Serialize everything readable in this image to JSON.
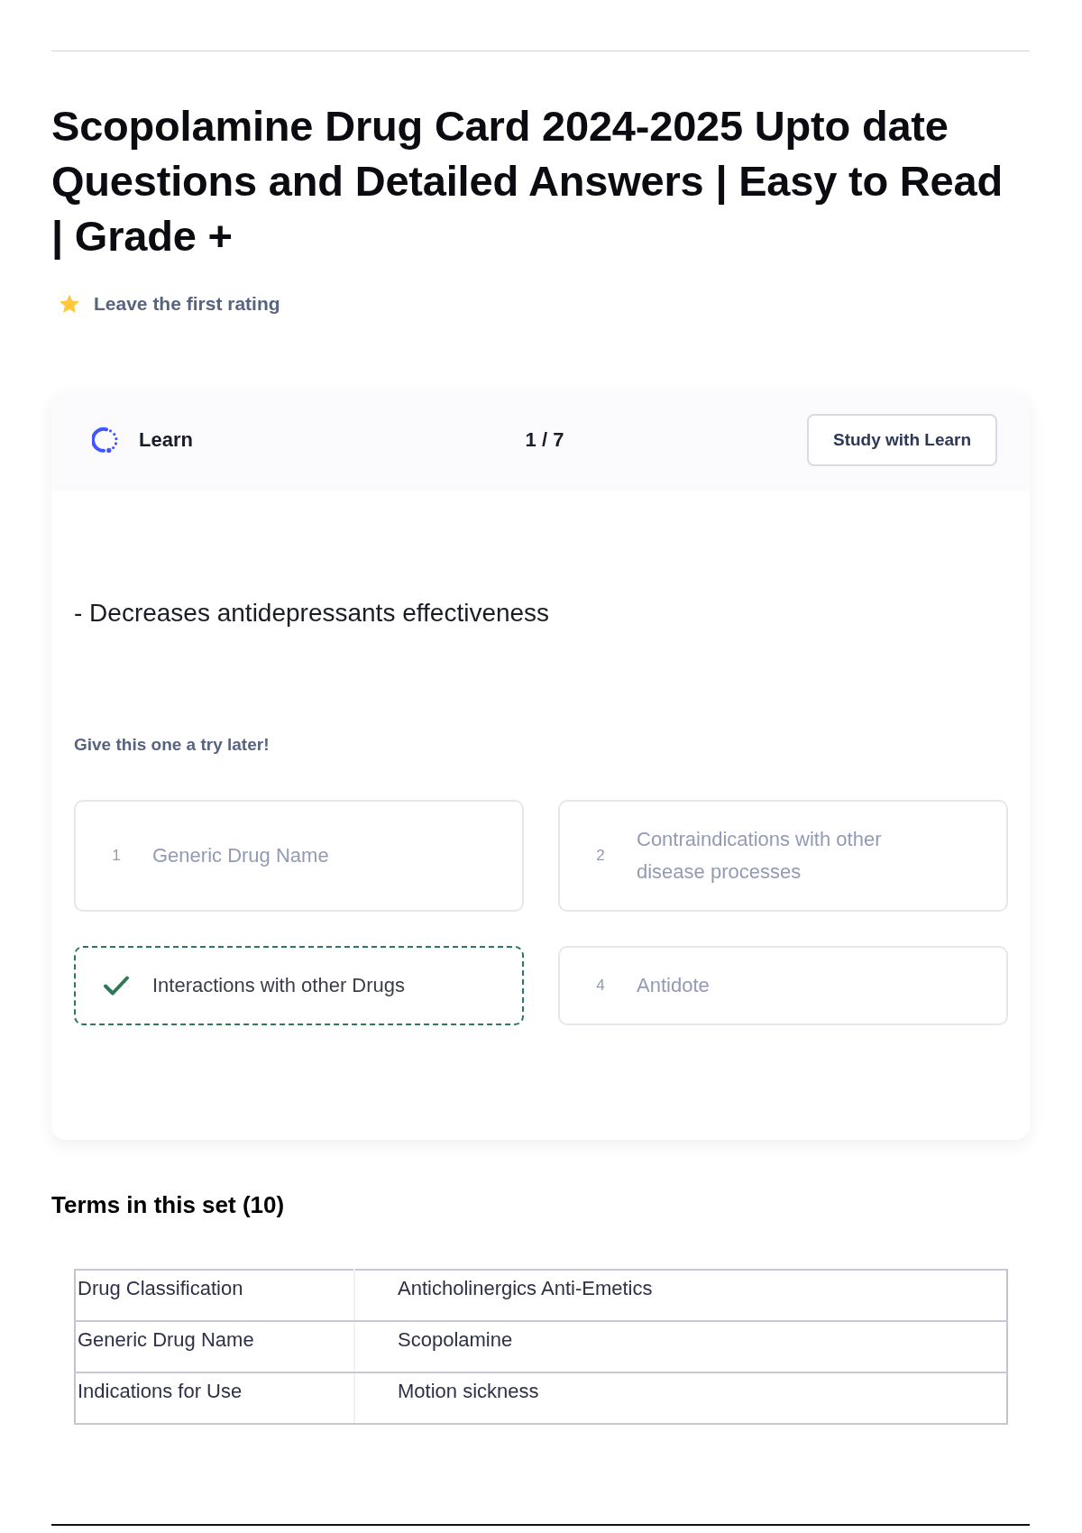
{
  "page": {
    "title": "Scopolamine Drug Card 2024-2025 Upto date Questions and Detailed Answers | Easy to Read | Grade +",
    "rating": {
      "label": "Leave the first rating"
    }
  },
  "learn_card": {
    "mode": "Learn",
    "progress": "1 / 7",
    "study_button": "Study with Learn",
    "answer": "- Decreases antidepressants effectiveness",
    "hint": "Give this one a try later!",
    "options": [
      {
        "number": "1",
        "text": "Generic Drug Name",
        "selected": false
      },
      {
        "number": "2",
        "text": "Contraindications with other disease processes",
        "selected": false
      },
      {
        "text": "Interactions with other Drugs",
        "selected": true
      },
      {
        "number": "4",
        "text": "Antidote",
        "selected": false
      }
    ]
  },
  "terms": {
    "heading": "Terms in this set (10)",
    "rows": [
      {
        "term": "Drug Classification",
        "definition": "Anticholinergics Anti-Emetics"
      },
      {
        "term": "Generic Drug Name",
        "definition": "Scopolamine"
      },
      {
        "term": "Indications for Use",
        "definition": "Motion sickness"
      }
    ]
  }
}
